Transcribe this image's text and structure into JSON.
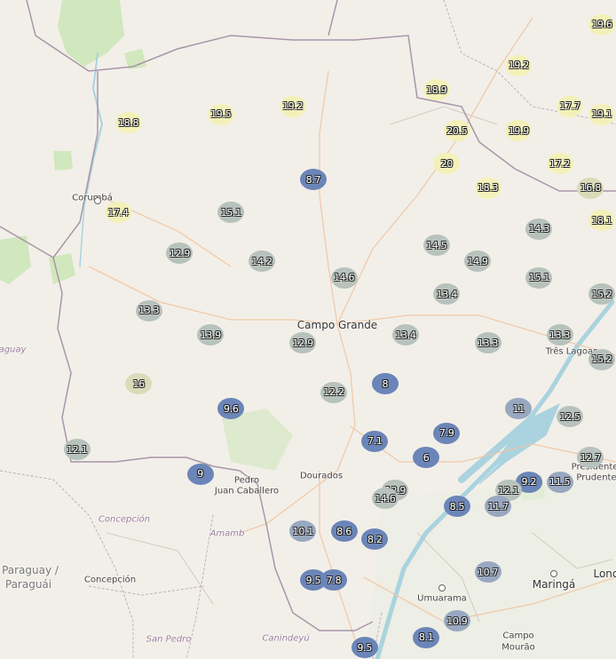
{
  "colors": {
    "warm": "#f3f1b8",
    "mild": "#d9dcb8",
    "cool": "#b8c2bd",
    "cold": "#6b85b8",
    "state_border": "#9b8f9b",
    "river": "#aad3df",
    "road": "#f0c6a2",
    "land": "#f2efe9",
    "forest": "#c8e6b0"
  },
  "place_labels": [
    {
      "id": "campo-grande",
      "text": "Campo Grande",
      "kind": "city"
    },
    {
      "id": "corumba",
      "text": "Corumbá",
      "kind": "town"
    },
    {
      "id": "dourados",
      "text": "Dourados",
      "kind": "town"
    },
    {
      "id": "pedro",
      "text": "Pedro",
      "kind": "town"
    },
    {
      "id": "juan-caballero",
      "text": "Juan Caballero",
      "kind": "town"
    },
    {
      "id": "tres-lagoas",
      "text": "Três Lagoas",
      "kind": "town"
    },
    {
      "id": "presidente",
      "text": "Presidente",
      "kind": "town"
    },
    {
      "id": "prudente",
      "text": "Prudente",
      "kind": "town"
    },
    {
      "id": "concepcion-region",
      "text": "Concepción",
      "kind": "region"
    },
    {
      "id": "amambay",
      "text": "Amamb",
      "kind": "region"
    },
    {
      "id": "concepcion-town",
      "text": "Concepción",
      "kind": "town"
    },
    {
      "id": "paraguay",
      "text": "Paraguay /",
      "kind": "country"
    },
    {
      "id": "paraguai",
      "text": "Paraguái",
      "kind": "country"
    },
    {
      "id": "paraguay-left",
      "text": "aguay",
      "kind": "region"
    },
    {
      "id": "umuarama",
      "text": "Umuarama",
      "kind": "town"
    },
    {
      "id": "maringa",
      "text": "Maringá",
      "kind": "city"
    },
    {
      "id": "londrina",
      "text": "Lond",
      "kind": "city"
    },
    {
      "id": "campo",
      "text": "Campo",
      "kind": "town"
    },
    {
      "id": "mourao",
      "text": "Mourão",
      "kind": "town"
    },
    {
      "id": "san-pedro",
      "text": "San Pedro",
      "kind": "region"
    },
    {
      "id": "canindeyu",
      "text": "Canindeyú",
      "kind": "region"
    }
  ],
  "temperature_markers": [
    {
      "value": "19.6",
      "lon": -50.1,
      "lat": -17.3
    },
    {
      "value": "19.2",
      "lon": -51.3,
      "lat": -17.8
    },
    {
      "value": "18.9",
      "lon": -52.1,
      "lat": -18.1
    },
    {
      "value": "19.5",
      "lon": -54.2,
      "lat": -18.4
    },
    {
      "value": "19.2",
      "lon": -53.5,
      "lat": -18.3
    },
    {
      "value": "18.8",
      "lon": -55.1,
      "lat": -18.5
    },
    {
      "value": "20.5",
      "lon": -51.9,
      "lat": -18.6
    },
    {
      "value": "19.9",
      "lon": -51.3,
      "lat": -18.6
    },
    {
      "value": "17.7",
      "lon": -50.8,
      "lat": -18.3
    },
    {
      "value": "19.1",
      "lon": -49.9,
      "lat": -18.4
    },
    {
      "value": "20",
      "lon": -52.0,
      "lat": -19.0
    },
    {
      "value": "8.7",
      "lon": -53.3,
      "lat": -19.2
    },
    {
      "value": "17.2",
      "lon": -50.9,
      "lat": -19.0
    },
    {
      "value": "18.3",
      "lon": -51.6,
      "lat": -19.3
    },
    {
      "value": "16.8",
      "lon": -50.6,
      "lat": -19.3
    },
    {
      "value": "17.4",
      "lon": -55.2,
      "lat": -19.6
    },
    {
      "value": "15.1",
      "lon": -54.1,
      "lat": -19.6
    },
    {
      "value": "18.1",
      "lon": -50.0,
      "lat": -19.7
    },
    {
      "value": "14.3",
      "lon": -51.1,
      "lat": -19.8
    },
    {
      "value": "14.5",
      "lon": -52.1,
      "lat": -20.0
    },
    {
      "value": "12.9",
      "lon": -54.6,
      "lat": -20.1
    },
    {
      "value": "14.2",
      "lon": -53.8,
      "lat": -20.2
    },
    {
      "value": "14.9",
      "lon": -51.7,
      "lat": -20.2
    },
    {
      "value": "14.6",
      "lon": -53.0,
      "lat": -20.4
    },
    {
      "value": "15.1",
      "lon": -51.1,
      "lat": -20.4
    },
    {
      "value": "13.4",
      "lon": -52.0,
      "lat": -20.6
    },
    {
      "value": "15.2",
      "lon": -50.4,
      "lat": -20.6
    },
    {
      "value": "13.3",
      "lon": -54.9,
      "lat": -20.8
    },
    {
      "value": "13.9",
      "lon": -54.3,
      "lat": -21.1
    },
    {
      "value": "12.9",
      "lon": -53.4,
      "lat": -21.2
    },
    {
      "value": "13.4",
      "lon": -52.4,
      "lat": -21.1
    },
    {
      "value": "13.3",
      "lon": -51.6,
      "lat": -21.2
    },
    {
      "value": "13.3",
      "lon": -50.9,
      "lat": -21.1
    },
    {
      "value": "15.2",
      "lon": -50.0,
      "lat": -21.4
    },
    {
      "value": "16",
      "lon": -55.0,
      "lat": -21.7
    },
    {
      "value": "8",
      "lon": -52.6,
      "lat": -21.7
    },
    {
      "value": "12.2",
      "lon": -53.1,
      "lat": -21.8
    },
    {
      "value": "9.6",
      "lon": -54.1,
      "lat": -22.0
    },
    {
      "value": "11",
      "lon": -51.3,
      "lat": -22.0
    },
    {
      "value": "12.5",
      "lon": -50.8,
      "lat": -22.1
    },
    {
      "value": "7.9",
      "lon": -52.0,
      "lat": -22.3
    },
    {
      "value": "12.1",
      "lon": -55.6,
      "lat": -22.5
    },
    {
      "value": "7.1",
      "lon": -52.7,
      "lat": -22.4
    },
    {
      "value": "6",
      "lon": -52.2,
      "lat": -22.6
    },
    {
      "value": "12.7",
      "lon": -50.6,
      "lat": -22.6
    },
    {
      "value": "9",
      "lon": -54.4,
      "lat": -22.8
    },
    {
      "value": "11.5",
      "lon": -50.9,
      "lat": -22.9
    },
    {
      "value": "9.2",
      "lon": -51.2,
      "lat": -22.9
    },
    {
      "value": "12.9",
      "lon": -52.5,
      "lat": -23.0
    },
    {
      "value": "12.1",
      "lon": -51.4,
      "lat": -23.0
    },
    {
      "value": "14.6",
      "lon": -52.6,
      "lat": -23.1
    },
    {
      "value": "8.5",
      "lon": -51.9,
      "lat": -23.2
    },
    {
      "value": "11.7",
      "lon": -51.5,
      "lat": -23.2
    },
    {
      "value": "10.1",
      "lon": -53.4,
      "lat": -23.5
    },
    {
      "value": "8.6",
      "lon": -53.0,
      "lat": -23.5
    },
    {
      "value": "8.2",
      "lon": -52.7,
      "lat": -23.6
    },
    {
      "value": "10.7",
      "lon": -51.6,
      "lat": -24.0
    },
    {
      "value": "9.5",
      "lon": -53.3,
      "lat": -24.1
    },
    {
      "value": "7.8",
      "lon": -53.1,
      "lat": -24.1
    },
    {
      "value": "10.9",
      "lon": -51.9,
      "lat": -24.6
    },
    {
      "value": "8.1",
      "lon": -52.2,
      "lat": -24.8
    },
    {
      "value": "9.5",
      "lon": -52.8,
      "lat": -25.2
    }
  ]
}
